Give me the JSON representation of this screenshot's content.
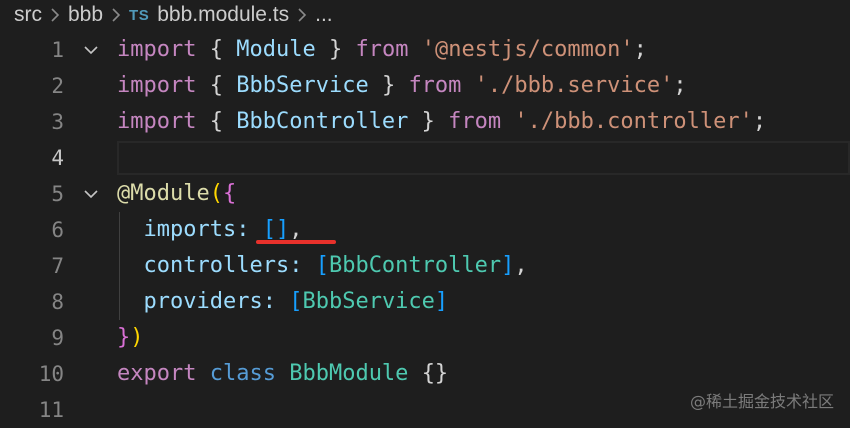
{
  "breadcrumb": {
    "items": [
      "src",
      "bbb",
      "bbb.module.ts",
      "..."
    ],
    "file_type_badge": "TS",
    "separator": ">"
  },
  "editor": {
    "active_line": 4,
    "lines": [
      {
        "number": "1",
        "foldable": true,
        "segments": [
          {
            "t": "import",
            "c": "kw"
          },
          {
            "t": " ",
            "c": "p"
          },
          {
            "t": "{",
            "c": "p"
          },
          {
            "t": " ",
            "c": "p"
          },
          {
            "t": "Module",
            "c": "id"
          },
          {
            "t": " ",
            "c": "p"
          },
          {
            "t": "}",
            "c": "p"
          },
          {
            "t": " ",
            "c": "p"
          },
          {
            "t": "from",
            "c": "kw"
          },
          {
            "t": " ",
            "c": "p"
          },
          {
            "t": "'@nestjs/common'",
            "c": "str"
          },
          {
            "t": ";",
            "c": "p"
          }
        ]
      },
      {
        "number": "2",
        "foldable": false,
        "segments": [
          {
            "t": "import",
            "c": "kw"
          },
          {
            "t": " ",
            "c": "p"
          },
          {
            "t": "{",
            "c": "p"
          },
          {
            "t": " ",
            "c": "p"
          },
          {
            "t": "BbbService",
            "c": "id"
          },
          {
            "t": " ",
            "c": "p"
          },
          {
            "t": "}",
            "c": "p"
          },
          {
            "t": " ",
            "c": "p"
          },
          {
            "t": "from",
            "c": "kw"
          },
          {
            "t": " ",
            "c": "p"
          },
          {
            "t": "'./bbb.service'",
            "c": "str"
          },
          {
            "t": ";",
            "c": "p"
          }
        ]
      },
      {
        "number": "3",
        "foldable": false,
        "segments": [
          {
            "t": "import",
            "c": "kw"
          },
          {
            "t": " ",
            "c": "p"
          },
          {
            "t": "{",
            "c": "p"
          },
          {
            "t": " ",
            "c": "p"
          },
          {
            "t": "BbbController",
            "c": "id"
          },
          {
            "t": " ",
            "c": "p"
          },
          {
            "t": "}",
            "c": "p"
          },
          {
            "t": " ",
            "c": "p"
          },
          {
            "t": "from",
            "c": "kw"
          },
          {
            "t": " ",
            "c": "p"
          },
          {
            "t": "'./bbb.controller'",
            "c": "str"
          },
          {
            "t": ";",
            "c": "p"
          }
        ]
      },
      {
        "number": "4",
        "foldable": false,
        "segments": []
      },
      {
        "number": "5",
        "foldable": true,
        "segments": [
          {
            "t": "@",
            "c": "fn"
          },
          {
            "t": "Module",
            "c": "fn"
          },
          {
            "t": "(",
            "c": "b1"
          },
          {
            "t": "{",
            "c": "b2"
          }
        ]
      },
      {
        "number": "6",
        "foldable": false,
        "segments": [
          {
            "t": "  ",
            "c": "p"
          },
          {
            "t": "imports",
            "c": "id"
          },
          {
            "t": ":",
            "c": "id"
          },
          {
            "t": " ",
            "c": "p"
          },
          {
            "t": "[]",
            "c": "b3"
          },
          {
            "t": ",",
            "c": "p"
          }
        ]
      },
      {
        "number": "7",
        "foldable": false,
        "segments": [
          {
            "t": "  ",
            "c": "p"
          },
          {
            "t": "controllers",
            "c": "id"
          },
          {
            "t": ":",
            "c": "id"
          },
          {
            "t": " ",
            "c": "p"
          },
          {
            "t": "[",
            "c": "b3"
          },
          {
            "t": "BbbController",
            "c": "cls"
          },
          {
            "t": "]",
            "c": "b3"
          },
          {
            "t": ",",
            "c": "p"
          }
        ]
      },
      {
        "number": "8",
        "foldable": false,
        "segments": [
          {
            "t": "  ",
            "c": "p"
          },
          {
            "t": "providers",
            "c": "id"
          },
          {
            "t": ":",
            "c": "id"
          },
          {
            "t": " ",
            "c": "p"
          },
          {
            "t": "[",
            "c": "b3"
          },
          {
            "t": "BbbService",
            "c": "cls"
          },
          {
            "t": "]",
            "c": "b3"
          }
        ]
      },
      {
        "number": "9",
        "foldable": false,
        "segments": [
          {
            "t": "}",
            "c": "b2"
          },
          {
            "t": ")",
            "c": "b1"
          }
        ]
      },
      {
        "number": "10",
        "foldable": false,
        "segments": [
          {
            "t": "export",
            "c": "kw"
          },
          {
            "t": " ",
            "c": "p"
          },
          {
            "t": "class",
            "c": "kwb"
          },
          {
            "t": " ",
            "c": "p"
          },
          {
            "t": "BbbModule",
            "c": "cls"
          },
          {
            "t": " ",
            "c": "p"
          },
          {
            "t": "{}",
            "c": "p"
          }
        ]
      },
      {
        "number": "11",
        "foldable": false,
        "segments": []
      }
    ]
  },
  "watermark": "@稀土掘金技术社区",
  "colors": {
    "background": "#1e1e1e",
    "keyword": "#c586c0",
    "string": "#ce9178",
    "identifier": "#9cdcfe",
    "class": "#4ec9b0",
    "annotation_underline": "#e8312b"
  }
}
